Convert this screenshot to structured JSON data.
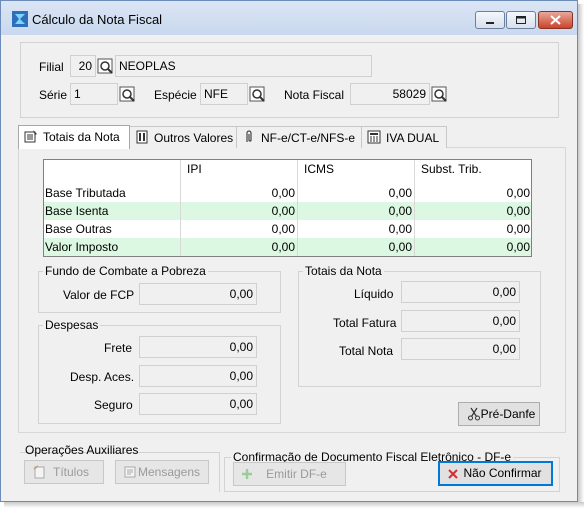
{
  "window": {
    "title": "Cálculo da Nota Fiscal"
  },
  "header": {
    "filial_label": "Filial",
    "filial_code": "20",
    "filial_name": "NEOPLAS",
    "serie_label": "Série",
    "serie_value": "1",
    "especie_label": "Espécie",
    "especie_value": "NFE",
    "nota_label": "Nota Fiscal",
    "nota_value": "58029"
  },
  "tabs": [
    {
      "label": "Totais da Nota",
      "icon": "calculator-pen-icon",
      "active": true
    },
    {
      "label": "Outros Valores",
      "icon": "building-icon",
      "active": false
    },
    {
      "label": "NF-e/CT-e/NFS-e",
      "icon": "paperclip-icon",
      "active": false
    },
    {
      "label": "IVA DUAL",
      "icon": "calculator-icon",
      "active": false
    }
  ],
  "totals_grid": {
    "columns": [
      "",
      "IPI",
      "ICMS",
      "Subst. Trib."
    ],
    "rows": [
      {
        "label": "Base Tributada",
        "values": [
          "0,00",
          "0,00",
          "0,00"
        ]
      },
      {
        "label": "Base Isenta",
        "values": [
          "0,00",
          "0,00",
          "0,00"
        ]
      },
      {
        "label": "Base Outras",
        "values": [
          "0,00",
          "0,00",
          "0,00"
        ]
      },
      {
        "label": "Valor Imposto",
        "values": [
          "0,00",
          "0,00",
          "0,00"
        ]
      }
    ],
    "alt_row_color": "#dcf7e2"
  },
  "fcp": {
    "title": "Fundo de Combate a Pobreza",
    "label": "Valor de FCP",
    "value": "0,00"
  },
  "despesas": {
    "title": "Despesas",
    "frete_label": "Frete",
    "frete_value": "0,00",
    "desp_label": "Desp. Aces.",
    "desp_value": "0,00",
    "seguro_label": "Seguro",
    "seguro_value": "0,00"
  },
  "totais_nota": {
    "title": "Totais da Nota",
    "liquido_label": "Líquido",
    "liquido_value": "0,00",
    "fatura_label": "Total Fatura",
    "fatura_value": "0,00",
    "nota_label": "Total Nota",
    "nota_value": "0,00"
  },
  "pre_danfe_label": "Pré-Danfe",
  "operacoes": {
    "title": "Operações Auxiliares",
    "titulos_label": "Títulos",
    "mensagens_label": "Mensagens"
  },
  "confirmacao": {
    "title": "Confirmação de Documento Fiscal Eletrônico - DF-e",
    "emitir_label": "Emitir DF-e",
    "nao_confirmar_label": "Não Confirmar"
  },
  "colors": {
    "accent": "#0078d7",
    "close_red": "#c9442d",
    "cancel_x": "#d03030"
  }
}
